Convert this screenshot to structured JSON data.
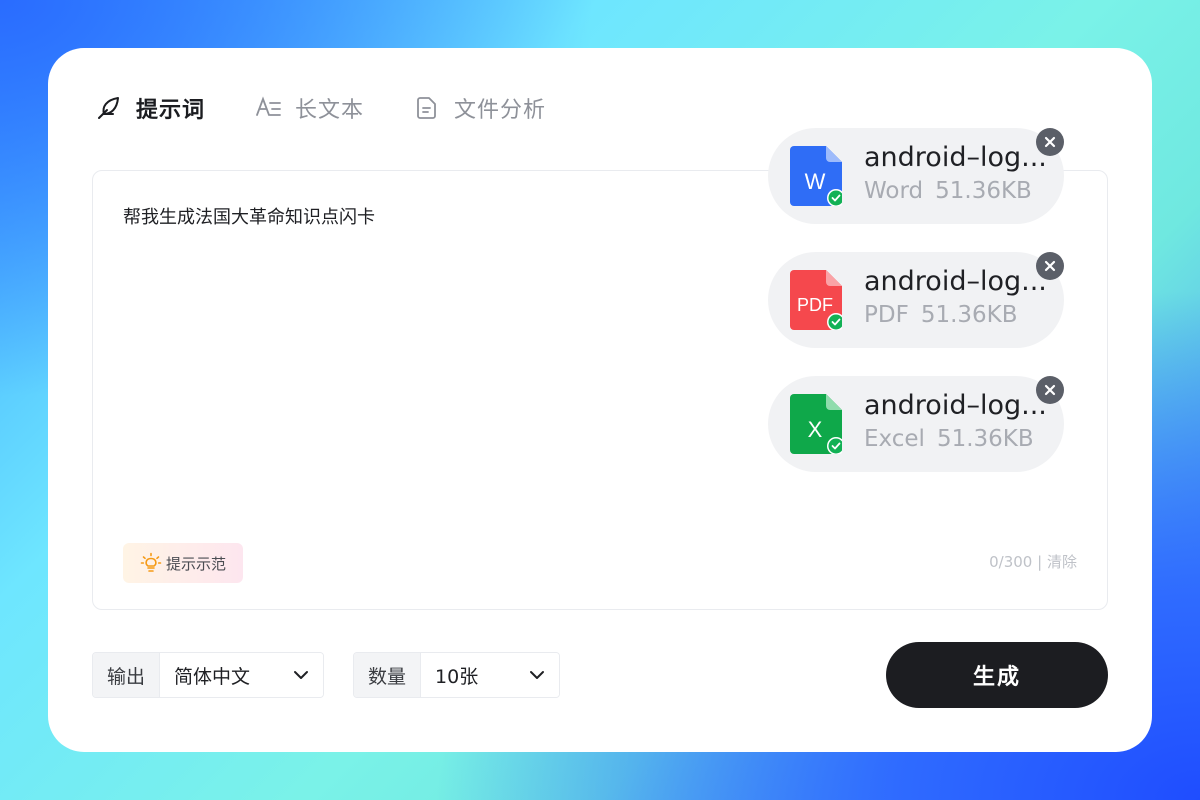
{
  "tabs": [
    {
      "label": "提示词",
      "icon": "feather-icon",
      "active": true
    },
    {
      "label": "长文本",
      "icon": "text-icon",
      "active": false
    },
    {
      "label": "文件分析",
      "icon": "document-icon",
      "active": false
    }
  ],
  "editor": {
    "prompt_text": "帮我生成法国大革命知识点闪卡",
    "hint_label": "提示示范",
    "counter": "0/300",
    "separator": "|",
    "clear_label": "清除"
  },
  "files": [
    {
      "name": "android–log...",
      "type": "Word",
      "size": "51.36KB",
      "badge": "W",
      "color": "#2f6df6",
      "icon": "word-file-icon"
    },
    {
      "name": "android–log...",
      "type": "PDF",
      "size": "51.36KB",
      "badge": "PDF",
      "color": "#f5484d",
      "icon": "pdf-file-icon"
    },
    {
      "name": "android–log...",
      "type": "Excel",
      "size": "51.36KB",
      "badge": "X",
      "color": "#0fa84a",
      "icon": "excel-file-icon"
    }
  ],
  "controls": {
    "output_label": "输出",
    "output_value": "简体中文",
    "count_label": "数量",
    "count_value": "10张",
    "generate_label": "生成"
  },
  "colors": {
    "accent": "#1c1d21",
    "check": "#12b155"
  }
}
